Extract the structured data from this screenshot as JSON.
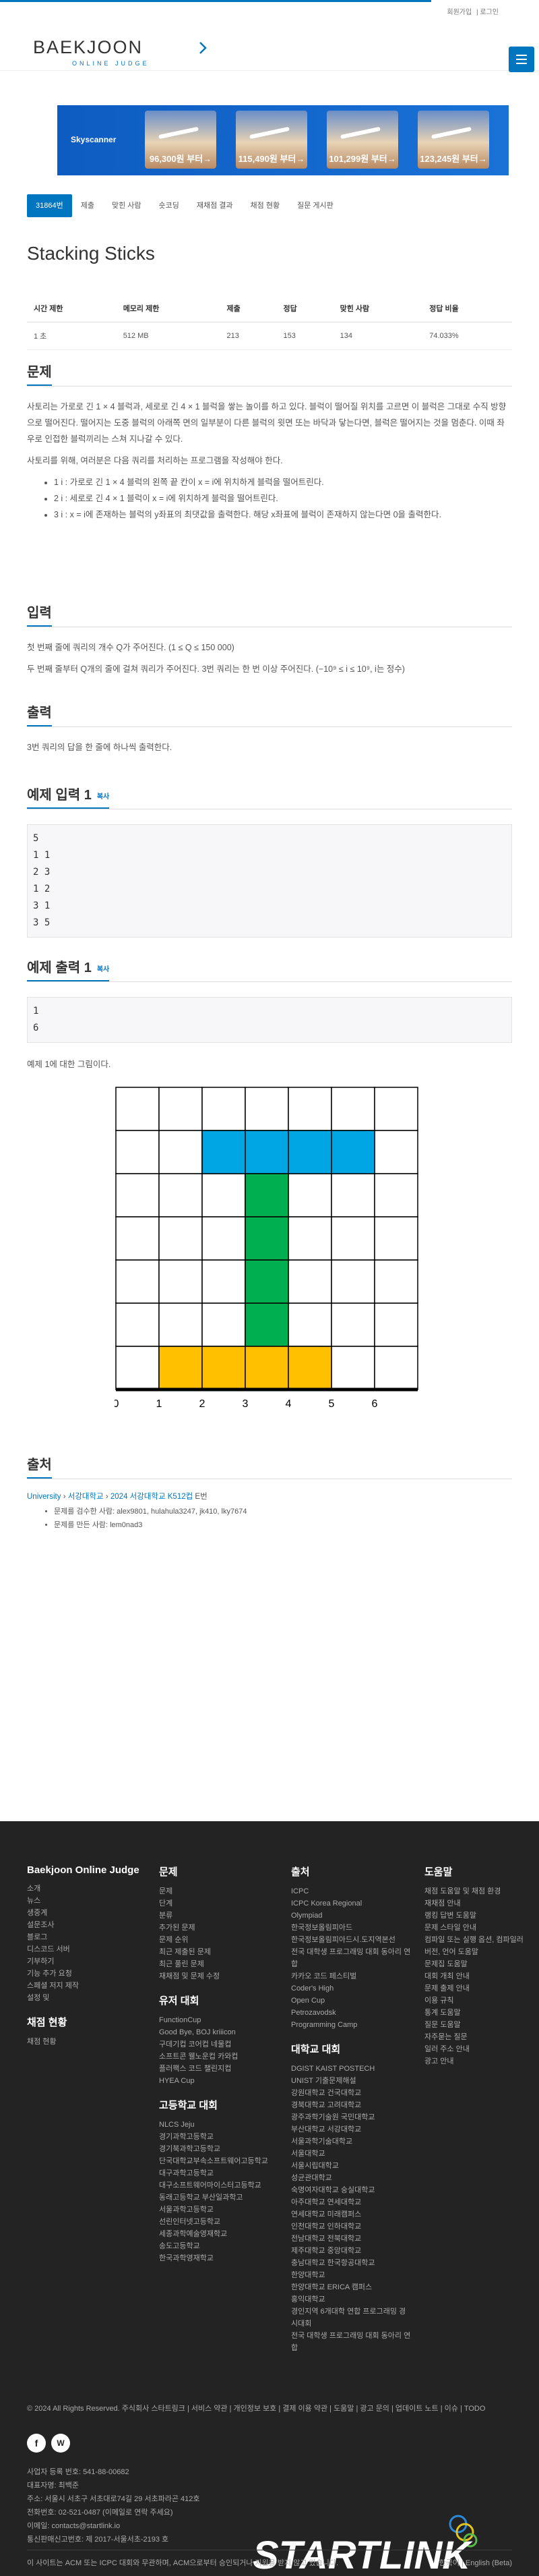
{
  "topnav": {
    "signup": "회원가입",
    "login": "로그인"
  },
  "brand": {
    "logo_main": "BAEKJOON",
    "logo_sub": "ONLINE JUDGE",
    "accent": "#0076c0"
  },
  "ad": {
    "brand": "Skyscanner",
    "prices": [
      "96,300원 부터→",
      "115,490원 부터→",
      "101,299원 부터→",
      "123,245원 부터→"
    ]
  },
  "tabs": [
    {
      "label": "31864번"
    },
    {
      "label": "제출"
    },
    {
      "label": "맞힌 사람"
    },
    {
      "label": "숏코딩"
    },
    {
      "label": "재채점 결과"
    },
    {
      "label": "채점 현황"
    },
    {
      "label": "질문 게시판"
    }
  ],
  "problem": {
    "title": "Stacking Sticks",
    "table_headers": [
      "시간 제한",
      "메모리 제한",
      "제출",
      "정답",
      "맞힌 사람",
      "정답 비율"
    ],
    "table_values": [
      "1 초",
      "512 MB",
      "213",
      "153",
      "134",
      "74.033%"
    ]
  },
  "sections": {
    "problem_heading": "문제",
    "problem_p1": "사토리는 가로로 긴 1 × 4 블럭과, 세로로 긴 4 × 1 블럭을 쌓는 놀이를 하고 있다. 블럭이 떨어질 위치를 고르면 이 블럭은 그대로 수직 방향으로 떨어진다. 떨어지는 도중 블럭의 아래쪽 면의 일부분이 다른 블럭의 윗면 또는 바닥과 닿는다면, 블럭은 떨어지는 것을 멈춘다. 이때 좌우로 인접한 블럭끼리는 스쳐 지나갈 수 있다.",
    "problem_p2": "사토리를 위해, 여러분은 다음 쿼리를 처리하는 프로그램을 작성해야 한다.",
    "bullets": [
      "1 i : 가로로 긴 1 × 4 블럭의 왼쪽 끝 칸이 x = i에 위치하게 블럭을 떨어트린다.",
      "2 i : 세로로 긴 4 × 1 블럭이 x = i에 위치하게 블럭을 떨어트린다.",
      "3 i : x = i에 존재하는 블럭의 y좌표의 최댓값을 출력한다. 해당 x좌표에 블럭이 존재하지 않는다면 0을 출력한다."
    ],
    "input_heading": "입력",
    "input_p1": "첫 번째 줄에 쿼리의 개수 Q가 주어진다. (1 ≤ Q ≤ 150 000)",
    "input_p2": "두 번째 줄부터 Q개의 줄에 걸쳐 쿼리가 주어진다. 3번 쿼리는 한 번 이상 주어진다. (−10⁹ ≤ i ≤ 10⁹, i는 정수)",
    "output_heading": "출력",
    "output_p1": "3번 쿼리의 답을 한 줄에 하나씩 출력한다.",
    "sample_in_heading": "예제 입력 1",
    "sample_in": "5\n1 1\n2 3\n1 2\n3 1\n3 5",
    "sample_out_heading": "예제 출력 1",
    "sample_out": "1\n6",
    "copy_label": "복사",
    "sample_note": "예제 1에 대한 그림이다.",
    "source_heading": "출처",
    "source_path": [
      "University",
      "서강대학교",
      "2024 서강대학교 K512컵"
    ],
    "source_suffix": "E번",
    "source_items": [
      "문제를 검수한 사람: alex9801, hulahula3247, jk410, lky7674",
      "문제를 만든 사람: lem0nad3"
    ]
  },
  "figure": {
    "x_ticks": [
      "0",
      "1",
      "2",
      "3",
      "4",
      "5",
      "6"
    ],
    "colors": {
      "blue": "#00a5e3",
      "green": "#00b050",
      "yellow": "#ffc000"
    }
  },
  "footer": {
    "cols": [
      {
        "title": "Baekjoon Online Judge",
        "items": [
          "소개",
          "뉴스",
          "생중계",
          "설문조사",
          "블로그",
          "디스코드 서버",
          "기부하기",
          "기능 추가 요청",
          "스페셜 저지 제작",
          "설정 및"
        ],
        "sub_title": "채점 현황",
        "sub_items": [
          "채점 현황"
        ]
      },
      {
        "title": "문제",
        "items": [
          "문제",
          "단계",
          "분류",
          "추가된 문제",
          "문제 순위",
          "최근 제출된 문제",
          "최근 풀린 문제",
          "재채점 및 문제 수정"
        ],
        "sub_title": "유저 대회",
        "sub_items": [
          "FunctionCup",
          "Good Bye, BOJ kriiicon",
          "구데기컵 코어컵 네물컵",
          "소프트콘 웰노운컵 카와컵",
          "플러팩스 코드 챌린지컵",
          "HYEA Cup"
        ],
        "sub2_title": "고등학교 대회",
        "sub2_items": [
          "NLCS Jeju",
          "경기과학고등학교",
          "경기북과학고등학교",
          "단국대학교부속소프트웨어고등학교",
          "대구과학고등학교",
          "대구소프트웨어마이스터고등학교",
          "동래고등학교 부산일과학고",
          "서울과학고등학교",
          "선린인터넷고등학교",
          "세종과학예술영재학교",
          "송도고등학교",
          "한국과학영재학교"
        ]
      },
      {
        "title": "출처",
        "items": [
          "ICPC",
          "ICPC Korea Regional",
          "Olympiad",
          "한국정보올림피아드",
          "한국정보올림피아드시.도지역본선",
          "전국 대학생 프로그래밍 대회 동아리 연합",
          "카카오 코드 페스티벌",
          "Coder's High",
          "Open Cup",
          "Petrozavodsk",
          "Programming Camp"
        ],
        "sub_title": "대학교 대회",
        "sub_items": [
          "DGIST KAIST POSTECH",
          "UNIST 기출문제해설",
          "강원대학교 건국대학교",
          "경북대학교 고려대학교",
          "광주과학기술원 국민대학교",
          "부산대학교 서강대학교",
          "서울과학기술대학교",
          "서울대학교",
          "서울시립대학교",
          "성균관대학교",
          "숙명여자대학교 숭실대학교",
          "아주대학교 연세대학교",
          "연세대학교 미래캠퍼스",
          "인천대학교 인하대학교",
          "전남대학교 전북대학교",
          "제주대학교 중앙대학교",
          "충남대학교 한국항공대학교",
          "한양대학교",
          "한양대학교 ERICA 캠퍼스",
          "홍익대학교",
          "경인지역 6개대학 연합 프로그래밍 경시대회",
          "전국 대학생 프로그래밍 대회 동아리 연합"
        ]
      },
      {
        "title": "도움말",
        "items": [
          "채점 도움말 및 채점 환경",
          "재채점 안내",
          "랭킹 답변 도움말",
          "문제 스타일 안내",
          "컴파일 또는 실행 옵션, 컴파일러 버전, 언어 도움말",
          "문제집 도움말",
          "대회 개최 안내",
          "문제 출제 안내",
          "이용 규칙",
          "통계 도움말",
          "질문 도움말",
          "자주묻는 질문",
          "일러 주소 안내",
          "광고 안내"
        ]
      }
    ],
    "copyright": "© 2024 All Rights Reserved. 주식회사 스타트링크  |  서비스 약관  |  개인정보 보호  |  결제 이용 약관  |  도움말  |  광고 문의  |  업데이트 노트  |  이슈  |  TODO",
    "company": [
      "사업자 등록 번호: 541-88-00682",
      "대표자명: 최백준",
      "주소: 서울시 서초구 서초대로74길 29 서초파라곤 412호",
      "전화번호: 02-521-0487 (이메일로 연락 주세요)",
      "이메일: contacts@startlink.io",
      "통신판매신고번호: 제 2017-서울서초-2193 호"
    ],
    "notice": "이 사이트는 ACM 또는 ICPC 대회와 무관하며, ACM으로부터 승인되거나 지원을 받지 않고 있습니다.",
    "lang": "한국어  |  English (Beta)",
    "sl_logo": "STARTLINK"
  }
}
